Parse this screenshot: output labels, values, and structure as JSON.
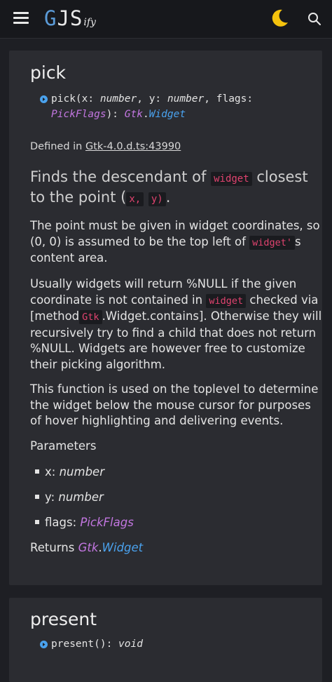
{
  "header": {
    "logo_g": "G",
    "logo_js": "JS",
    "logo_ify": "ify",
    "menu_icon": "hamburger-menu-icon",
    "theme_icon": "moon-icon",
    "search_icon": "search-icon",
    "accent": "#5b9bd8",
    "moon_color": "#f4c20d"
  },
  "pick": {
    "title": "pick",
    "signature": {
      "line1_prefix": "pick(x: ",
      "x_type": "number",
      "sep1": ", y: ",
      "y_type": "number",
      "sep2": ", flags:",
      "flags_type": "PickFlags",
      "ret_sep": "): ",
      "ret_ns": "Gtk",
      "ret_dot": ".",
      "ret_type": "Widget"
    },
    "defined_label": "Defined in ",
    "defined_link": "Gtk-4.0.d.ts:43990",
    "lead": {
      "t1": "Finds the descendant of ",
      "c1": "widget",
      "t2": " closest to the point (",
      "c2": "x,",
      "t3": " ",
      "c3": "y)",
      "t4": "."
    },
    "p1": {
      "t1": "The point must be given in widget coordinates, so (0, 0) is assumed to be the top left of ",
      "c1": "widget'",
      "t2": "s content area."
    },
    "p2": {
      "t1": "Usually widgets will return %NULL if the given coordinate is not contained in ",
      "c1": "widget",
      "t2": " checked via [method",
      "c2": "Gtk",
      "t3": ".Widget.contains]. Otherwise they will recursively try to find a child that does not return %NULL. Widgets are however free to customize their picking algorithm."
    },
    "p3": "This function is used on the toplevel to determine the widget below the mouse cursor for purposes of hover highlighting and delivering events.",
    "params_heading": "Parameters",
    "params": [
      {
        "name": "x: ",
        "type": "number"
      },
      {
        "name": "y: ",
        "type": "number"
      },
      {
        "name": "flags: ",
        "type": "PickFlags"
      }
    ],
    "returns_label": "Returns ",
    "returns_ns": "Gtk",
    "returns_dot": ".",
    "returns_type": "Widget"
  },
  "present": {
    "title": "present",
    "sig_prefix": "present(): ",
    "sig_type": "void"
  },
  "colors": {
    "code_text": "#e0436f",
    "type_purple": "#c276e0",
    "type_blue": "#4aa2ee",
    "card_bg": "#2b2c31",
    "page_bg": "#1e1f24"
  }
}
